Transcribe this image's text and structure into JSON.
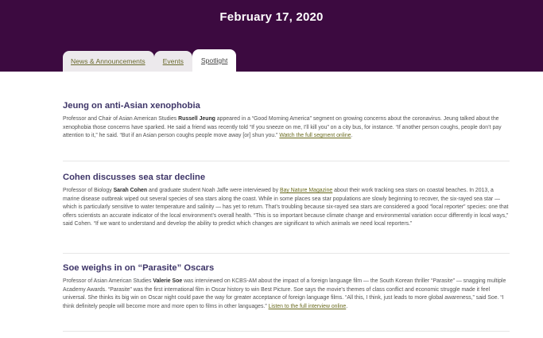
{
  "header": {
    "date": "February 17, 2020"
  },
  "tabs": [
    {
      "label": "News & Announcements"
    },
    {
      "label": "Events"
    },
    {
      "label": "Spotlight"
    }
  ],
  "articles": [
    {
      "title": "Jeung on anti-Asian xenophobia",
      "p1": "Professor and Chair of Asian American Studies ",
      "b1": "Russell Jeung",
      "p2": " appeared in a “Good Morning America” segment on growing concerns about the coronavirus. Jeung talked about the xenophobia those concerns have sparked. He said a friend was recently told “If you sneeze on me, I’ll kill you” on a city bus, for instance. “If another person coughs, people don’t pay attention to it,” he said. “But if an Asian person coughs people move away [or] shun you.” ",
      "link1": "Watch the full segment online",
      "p3": "."
    },
    {
      "title": "Cohen discusses sea star decline",
      "p1": "Professor of Biology ",
      "b1": "Sarah Cohen",
      "p2": " and graduate student Noah Jaffe were interviewed by ",
      "link1": "Bay Nature Magazine",
      "p3": " about their work tracking sea stars on coastal beaches. In 2013, a marine disease outbreak wiped out several species of sea stars along the coast. While in some places sea star populations are slowly beginning to recover, the six-rayed sea star — which is particularly sensitive to water temperature and salinity — has yet to return. That’s troubling because six-rayed sea stars are considered a good “local reporter” species: one that offers scientists an accurate indicator of the local environment’s overall health. “This is so important because climate change and environmental variation occur differently in local ways,” said Cohen. “If we want to understand and develop the ability to predict which changes are significant to which animals we need local reporters.”"
    },
    {
      "title": "Soe weighs in on “Parasite” Oscars",
      "p1": "Professor of Asian American Studies ",
      "b1": "Valerie Soe",
      "p2": " was interviewed on KCBS-AM about the impact of a foreign language film — the South Korean thriller “Parasite” — snagging multiple Academy Awards. “Parasite” was the first international film in Oscar history to win Best Picture. Soe says the movie’s themes of class conflict and economic struggle made it feel universal. She thinks its big win on Oscar night could pave the way for greater acceptance of foreign language films. “All this, I think, just leads to more global awareness,” said Soe. “I think definitely people will become more and more open to films in other languages.” ",
      "link1": "Listen to the full interview online",
      "p3": "."
    }
  ]
}
